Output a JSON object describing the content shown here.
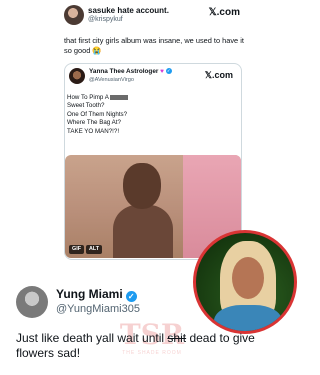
{
  "top_tweet": {
    "name": "sasuke hate account.",
    "handle": "@krispykuf",
    "platform": "𝕏.com",
    "text": "that first city girls album was insane, we used to have it so good 😭"
  },
  "quoted_tweet": {
    "name": "Yanna Thee Astrologer",
    "handle": "@AVenusianVirgo",
    "platform": "𝕏.com",
    "lines": [
      "How To Pimp A",
      "Sweet Tooth?",
      "One Of Them Nights?",
      "Where The Bag At?",
      "TAKE YO MAN?!?!"
    ],
    "media_badges": [
      "GIF",
      "ALT"
    ]
  },
  "main_tweet": {
    "name": "Yung Miami",
    "handle": "@YungMiami305",
    "text_before": "Just like death yall wait until",
    "strike_word": "shit",
    "text_after": "dead to give flowers sad!"
  },
  "watermark": {
    "logo": "TSR",
    "text": "THE SHADE ROOM"
  },
  "colors": {
    "verified": "#1d9bf0",
    "accent_red": "#d93434",
    "heart": "#d63bd6"
  }
}
